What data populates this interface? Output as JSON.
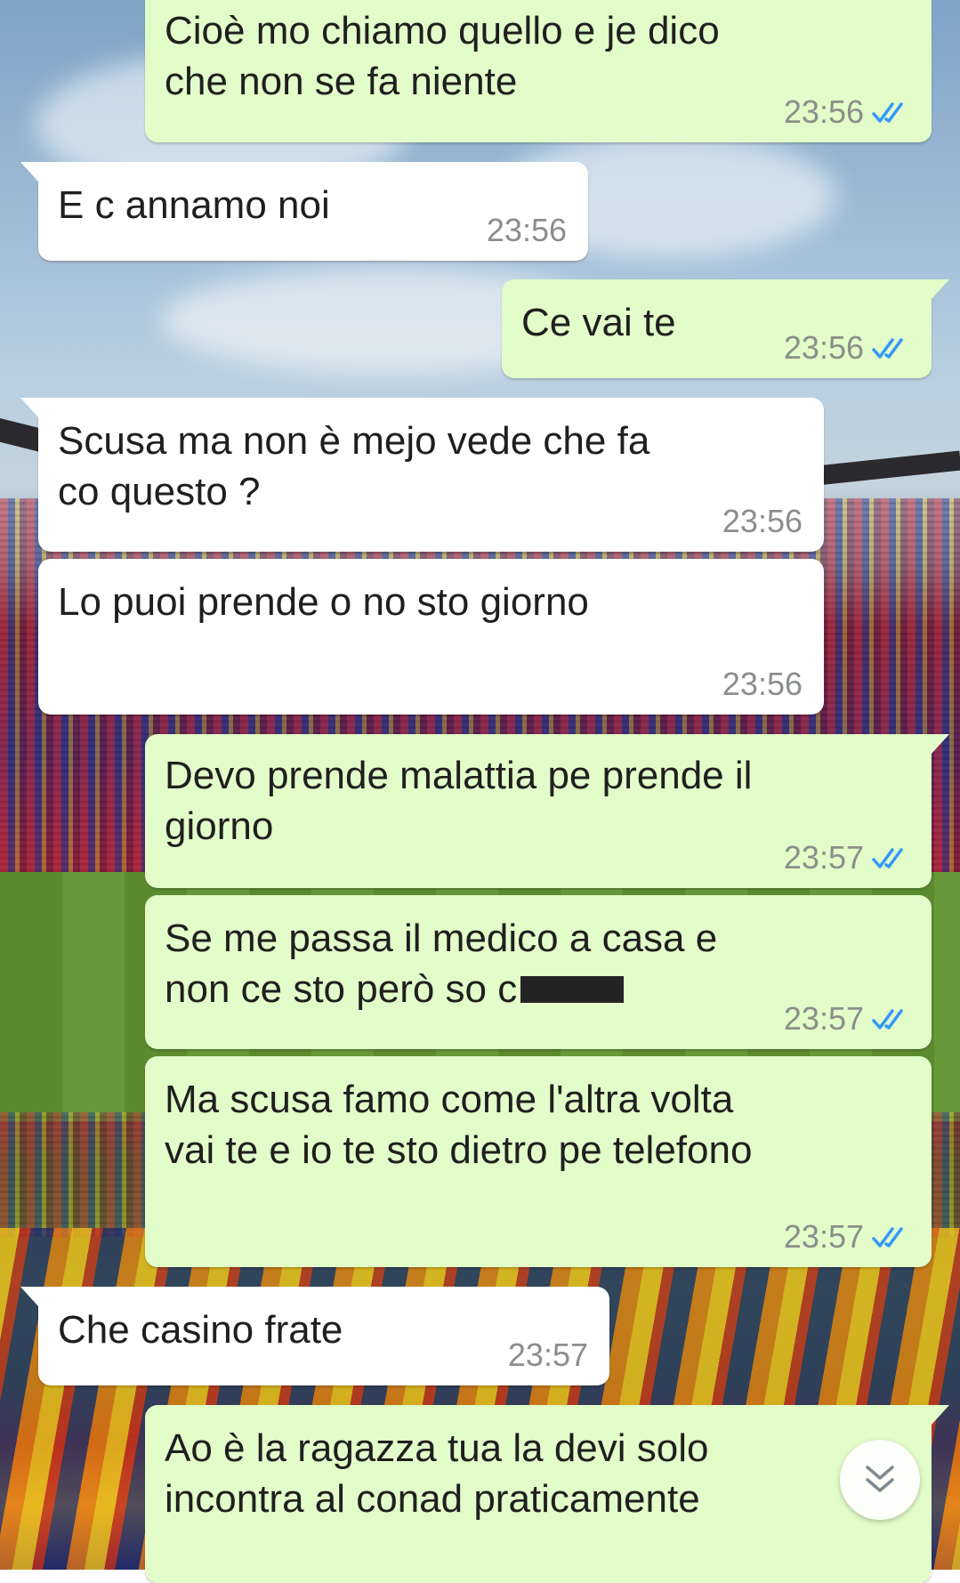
{
  "theme": {
    "incoming_bubble": "#ffffff",
    "outgoing_bubble": "#e2fdc9",
    "time_color": "#8a8f8a",
    "read_tick_color": "#3497f9",
    "background": "stadium-crowd-wallpaper"
  },
  "messages": [
    {
      "direction": "outgoing",
      "text": "Cioè mo chiamo quello e je dico\nche non se fa niente",
      "time": "23:56",
      "status": "read"
    },
    {
      "direction": "incoming",
      "text": "E c annamo noi",
      "time": "23:56"
    },
    {
      "direction": "outgoing",
      "text": "Ce vai te",
      "time": "23:56",
      "status": "read"
    },
    {
      "direction": "incoming",
      "text": "Scusa ma non è mejo vede che fa\nco questo ?",
      "time": "23:56"
    },
    {
      "direction": "incoming",
      "text": "Lo puoi prende o no sto giorno",
      "time": "23:56"
    },
    {
      "direction": "outgoing",
      "text": "Devo prende malattia pe prende il\ngiorno",
      "time": "23:57",
      "status": "read"
    },
    {
      "direction": "outgoing",
      "text": "Se me passa il medico a casa e\nnon ce sto però so c",
      "redacted": true,
      "time": "23:57",
      "status": "read"
    },
    {
      "direction": "outgoing",
      "text": "Ma scusa famo come l'altra volta\nvai te e io te sto dietro pe telefono",
      "time": "23:57",
      "status": "read"
    },
    {
      "direction": "incoming",
      "text": "Che casino frate",
      "time": "23:57"
    },
    {
      "direction": "outgoing",
      "text": "Ao è la ragazza tua la devi solo\nincontra al conad praticamente",
      "time": "",
      "status": ""
    }
  ],
  "icons": {
    "read_receipt": "double-check-icon",
    "scroll_down": "double-chevron-down-icon"
  }
}
